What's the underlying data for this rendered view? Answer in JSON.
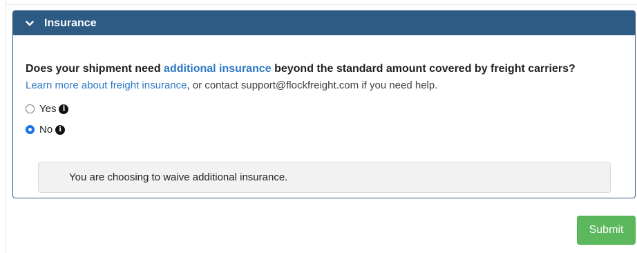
{
  "panel": {
    "title": "Insurance",
    "expanded_icon": "chevron-down-icon"
  },
  "question": {
    "prefix": "Does your shipment need ",
    "link": "additional insurance",
    "suffix": " beyond the standard amount covered by freight carriers?"
  },
  "help": {
    "link": "Learn more about freight insurance",
    "text": ", or contact support@flockfreight.com if you need help."
  },
  "options": [
    {
      "label": "Yes",
      "selected": false,
      "icon": "info-icon"
    },
    {
      "label": "No",
      "selected": true,
      "icon": "info-icon"
    }
  ],
  "notice": {
    "text": "You are choosing to waive additional insurance."
  },
  "actions": {
    "submit_label": "Submit"
  },
  "colors": {
    "header_bg": "#2e5b84",
    "link": "#2d78c4",
    "submit_bg": "#5cb85c",
    "radio_selected": "#1a73e8"
  }
}
